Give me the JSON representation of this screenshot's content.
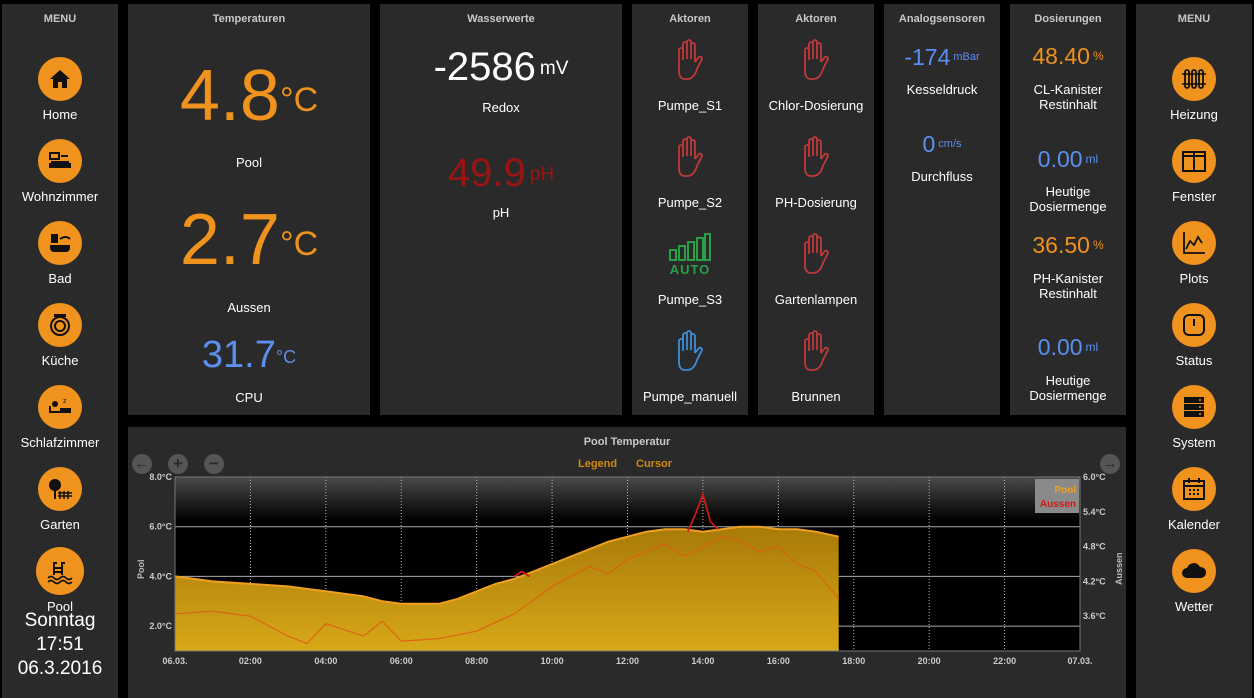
{
  "left_menu": {
    "title": "MENU",
    "items": [
      {
        "label": "Home",
        "icon": "home-icon"
      },
      {
        "label": "Wohnzimmer",
        "icon": "sofa-icon"
      },
      {
        "label": "Bad",
        "icon": "bath-icon"
      },
      {
        "label": "Küche",
        "icon": "kitchen-icon"
      },
      {
        "label": "Schlafzimmer",
        "icon": "bed-icon"
      },
      {
        "label": "Garten",
        "icon": "garden-icon"
      },
      {
        "label": "Pool",
        "icon": "pool-icon"
      }
    ],
    "day": "Sonntag",
    "time": "17:51",
    "date": "06.3.2016"
  },
  "right_menu": {
    "title": "MENU",
    "items": [
      {
        "label": "Heizung",
        "icon": "radiator-icon"
      },
      {
        "label": "Fenster",
        "icon": "window-icon"
      },
      {
        "label": "Plots",
        "icon": "chart-icon"
      },
      {
        "label": "Status",
        "icon": "power-icon"
      },
      {
        "label": "System",
        "icon": "server-icon"
      },
      {
        "label": "Kalender",
        "icon": "calendar-icon"
      },
      {
        "label": "Wetter",
        "icon": "cloud-icon"
      }
    ]
  },
  "temperaturen": {
    "title": "Temperaturen",
    "pool": {
      "value": "4.8",
      "unit": "°C",
      "label": "Pool"
    },
    "aussen": {
      "value": "2.7",
      "unit": "°C",
      "label": "Aussen"
    },
    "cpu": {
      "value": "31.7",
      "unit": "°C",
      "label": "CPU"
    }
  },
  "wasserwerte": {
    "title": "Wasserwerte",
    "redox": {
      "value": "-2586",
      "unit": "mV",
      "label": "Redox"
    },
    "ph": {
      "value": "49.9",
      "unit": "pH",
      "label": "pH"
    }
  },
  "aktoren1": {
    "title": "Aktoren",
    "items": [
      {
        "label": "Pumpe_S1",
        "state": "hand-red"
      },
      {
        "label": "Pumpe_S2",
        "state": "hand-red"
      },
      {
        "label": "Pumpe_S3",
        "state": "auto",
        "auto_text": "AUTO"
      },
      {
        "label": "Pumpe_manuell",
        "state": "hand-blue"
      }
    ]
  },
  "aktoren2": {
    "title": "Aktoren",
    "items": [
      {
        "label": "Chlor-Dosierung",
        "state": "hand-red"
      },
      {
        "label": "PH-Dosierung",
        "state": "hand-red"
      },
      {
        "label": "Gartenlampen",
        "state": "hand-red"
      },
      {
        "label": "Brunnen",
        "state": "hand-red"
      }
    ]
  },
  "analogsensoren": {
    "title": "Analogsensoren",
    "kesseldruck": {
      "value": "-174",
      "unit": "mBar",
      "label": "Kesseldruck"
    },
    "durchfluss": {
      "value": "0",
      "unit": "cm/s",
      "label": "Durchfluss"
    }
  },
  "dosierungen": {
    "title": "Dosierungen",
    "cl_kanister": {
      "value": "48.40",
      "unit": "%",
      "label1": "CL-Kanister",
      "label2": "Restinhalt"
    },
    "cl_heute": {
      "value": "0.00",
      "unit": "ml",
      "label1": "Heutige",
      "label2": "Dosiermenge"
    },
    "ph_kanister": {
      "value": "36.50",
      "unit": "%",
      "label1": "PH-Kanister",
      "label2": "Restinhalt"
    },
    "ph_heute": {
      "value": "0.00",
      "unit": "ml",
      "label1": "Heutige",
      "label2": "Dosiermenge"
    }
  },
  "colors": {
    "orange": "#f0921e",
    "blue": "#5b8ff0",
    "red_hand": "#c0393b",
    "blue_hand": "#3c8fd8",
    "green_auto": "#27a048",
    "dark_red": "#9a1414"
  },
  "chart_panel": {
    "title": "Pool Temperatur",
    "legend_label": "Legend",
    "cursor_label": "Cursor",
    "left_axis_title": "Pool",
    "right_axis_title": "Aussen",
    "legend_pool": "Pool",
    "legend_aussen": "Aussen"
  },
  "chart_data": {
    "type": "area",
    "title": "Pool Temperatur",
    "x_ticks": [
      "06.03.",
      "02:00",
      "04:00",
      "06:00",
      "08:00",
      "10:00",
      "12:00",
      "14:00",
      "16:00",
      "18:00",
      "20:00",
      "22:00",
      "07.03."
    ],
    "x_hours": [
      0,
      2,
      4,
      6,
      8,
      10,
      12,
      14,
      16,
      18,
      20,
      22,
      24
    ],
    "ylim_left": [
      1.0,
      8.0
    ],
    "y_ticks_left": [
      "2.0°C",
      "4.0°C",
      "6.0°C",
      "8.0°C"
    ],
    "y_ticks_left_values": [
      2,
      4,
      6,
      8
    ],
    "ylim_right": [
      3.0,
      6.0
    ],
    "y_ticks_right": [
      "3.6°C",
      "4.2°C",
      "4.8°C",
      "5.4°C",
      "6.0°C"
    ],
    "y_ticks_right_values": [
      3.6,
      4.2,
      4.8,
      5.4,
      6.0
    ],
    "grid": true,
    "legend_position": "top-right",
    "series": [
      {
        "name": "Pool",
        "color": "#f0a020",
        "x": [
          0,
          0.5,
          1,
          2,
          3,
          3.5,
          4,
          5,
          5.5,
          6,
          7,
          7.5,
          8,
          8.5,
          9,
          9.5,
          10,
          10.5,
          11,
          11.5,
          12,
          12.5,
          13,
          13.5,
          14,
          14.5,
          15,
          15.5,
          16,
          16.5,
          17,
          17.6
        ],
        "values": [
          4.0,
          3.9,
          3.8,
          3.7,
          3.6,
          3.5,
          3.4,
          3.2,
          3.0,
          2.9,
          2.9,
          3.1,
          3.4,
          3.7,
          3.9,
          4.2,
          4.5,
          4.8,
          5.1,
          5.4,
          5.6,
          5.8,
          5.9,
          5.9,
          5.8,
          5.9,
          6.0,
          6.0,
          5.9,
          5.9,
          5.8,
          5.6
        ]
      },
      {
        "name": "Aussen",
        "color": "#d01818",
        "x": [
          9.0,
          9.2,
          9.4,
          13.6,
          13.8,
          14.0,
          14.2,
          14.4
        ],
        "values": [
          4.0,
          4.2,
          4.0,
          5.8,
          6.5,
          7.3,
          6.2,
          5.9
        ]
      },
      {
        "name": "Aussen-trace",
        "color": "#e05a14",
        "x": [
          0,
          1,
          2,
          3,
          3.5,
          4,
          5,
          5.5,
          6,
          7,
          8,
          9,
          10,
          10.5,
          11,
          11.5,
          12,
          12.5,
          13,
          13.5,
          14,
          14.5,
          15,
          15.5,
          16,
          16.5,
          17,
          17.6
        ],
        "values": [
          2.5,
          2.6,
          2.4,
          1.6,
          1.3,
          2.1,
          1.6,
          2.2,
          1.4,
          1.5,
          1.8,
          2.5,
          3.6,
          4.0,
          4.4,
          4.1,
          4.7,
          5.0,
          5.3,
          4.8,
          5.2,
          5.6,
          5.4,
          5.0,
          5.2,
          4.5,
          4.2,
          3.1
        ]
      }
    ]
  }
}
